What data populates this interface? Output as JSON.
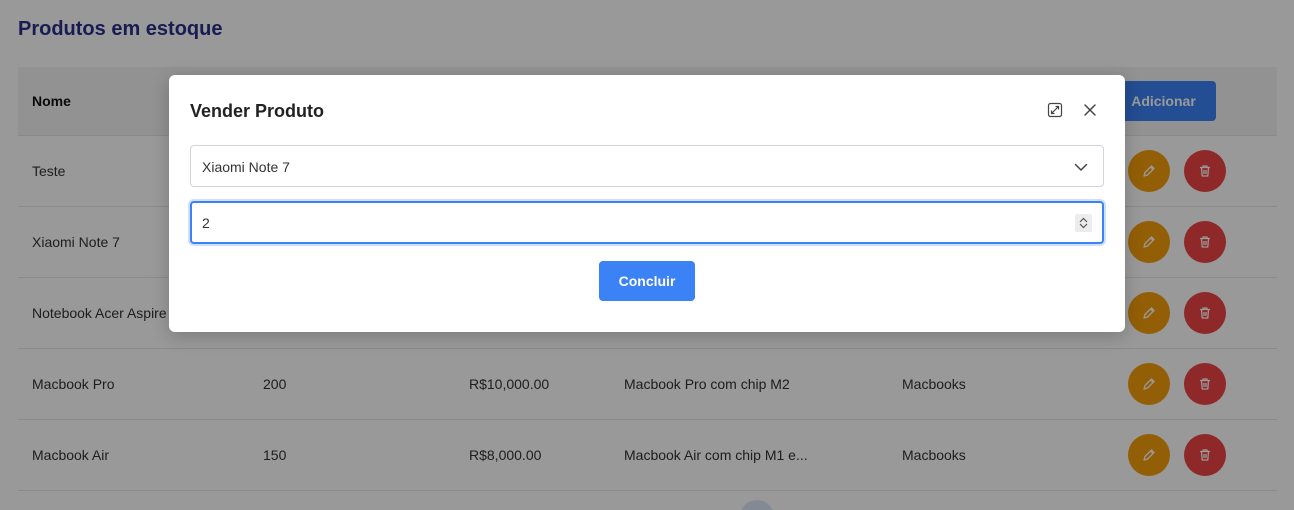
{
  "page": {
    "title": "Produtos em estoque",
    "add_button": "Adicionar",
    "columns": {
      "name": "Nome"
    }
  },
  "rows": [
    {
      "name": "Teste",
      "quantity": "",
      "price": "",
      "description": "",
      "category": ""
    },
    {
      "name": "Xiaomi Note 7",
      "quantity": "",
      "price": "",
      "description": "",
      "category": ""
    },
    {
      "name": "Notebook Acer Aspire",
      "quantity": "",
      "price": "",
      "description": "",
      "category": ""
    },
    {
      "name": "Macbook Pro",
      "quantity": "200",
      "price": "R$10,000.00",
      "description": "Macbook Pro com chip M2",
      "category": "Macbooks"
    },
    {
      "name": "Macbook Air",
      "quantity": "150",
      "price": "R$8,000.00",
      "description": "Macbook Air com chip M1 e...",
      "category": "Macbooks"
    }
  ],
  "modal": {
    "title": "Vender Produto",
    "product_select": {
      "selected": "Xiaomi Note 7"
    },
    "quantity_input": {
      "value": "2"
    },
    "submit_label": "Concluir"
  },
  "colors": {
    "primary": "#3b82f6",
    "edit": "#f59e0b",
    "delete": "#ef4444",
    "title": "#2b2d8a"
  }
}
